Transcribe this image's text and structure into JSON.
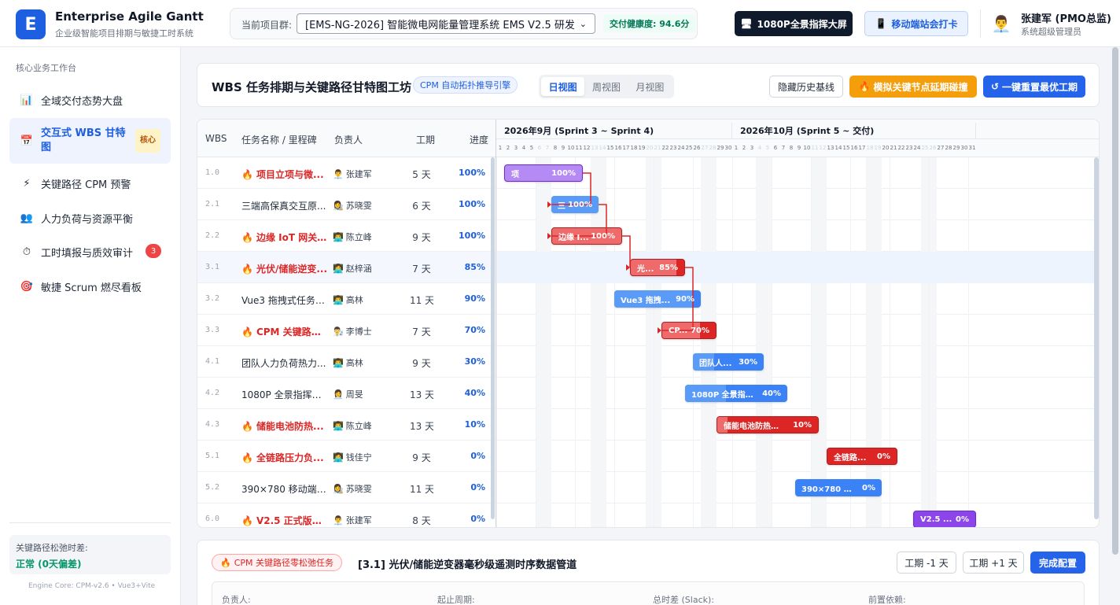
{
  "header": {
    "logo_letter": "E",
    "brand_title": "Enterprise Agile Gantt",
    "brand_sub": "企业级智能项目排期与敏捷工时系统",
    "project_label": "当前项目群:",
    "project_value": "[EMS-NG-2026] 智能微电网能量管理系统 EMS V2.5 研发",
    "health": "交付健康度: 94.6分",
    "screen_btn": "1080P全景指挥大屏",
    "mobile_btn": "移动端站会打卡",
    "user_name": "张建军 (PMO总监)",
    "user_role": "系统超级管理员"
  },
  "sidebar": {
    "title": "核心业务工作台",
    "items": [
      {
        "label": "全域交付态势大盘",
        "icon": "📊"
      },
      {
        "label": "交互式 WBS 甘特图",
        "icon": "📅",
        "badge": "核心"
      },
      {
        "label": "关键路径 CPM 预警",
        "icon": "⚡"
      },
      {
        "label": "人力负荷与资源平衡",
        "icon": "👥"
      },
      {
        "label": "工时填报与质效审计",
        "icon": "⏱",
        "count": "3"
      },
      {
        "label": "敏捷 Scrum 燃尽看板",
        "icon": "🎯"
      }
    ],
    "slack_label": "关键路径松弛时差:",
    "slack_value": "正常 (0天偏差)",
    "engine": "Engine Core: CPM-v2.6 • Vue3+Vite"
  },
  "toolbar": {
    "title": "WBS 任务排期与关键路径甘特图工坊",
    "engine_badge": "CPM 自动拓扑推导引擎",
    "views": [
      "日视图",
      "周视图",
      "月视图"
    ],
    "hide_baseline": "隐藏历史基线",
    "simulate": "模拟关键节点延期碰撞",
    "simulate_icon": "🔥",
    "reset": "一键重置最优工期",
    "reset_icon": "↺"
  },
  "gantt": {
    "columns": {
      "wbs": "WBS",
      "name": "任务名称 / 里程碑",
      "owner": "负责人",
      "duration": "工期",
      "progress": "进度"
    },
    "months": [
      "2026年9月 (Sprint 3 ~ Sprint 4)",
      "2026年10月 (Sprint 5 ~ 交付)"
    ],
    "crit_icon": "🔥",
    "colors": {
      "critical": "#dc2626",
      "normal": "#3b82f6",
      "milestone": "#8b45e8"
    },
    "tasks": [
      {
        "wbs": "1.0",
        "name": "项目立项与微...",
        "bar_name": "项",
        "owner": "张建军",
        "avatar": "👨‍💼",
        "duration": "5 天",
        "progress": "100%",
        "pct": 1.0,
        "critical": true,
        "color": "purple",
        "start": 1,
        "days": 5
      },
      {
        "wbs": "2.1",
        "name": "三端高保真交互原...",
        "bar_name": "三",
        "owner": "苏晓雯",
        "avatar": "👩‍🎨",
        "duration": "6 天",
        "progress": "100%",
        "pct": 1.0,
        "critical": false,
        "color": "blue",
        "start": 4,
        "days": 3
      },
      {
        "wbs": "2.2",
        "name": "边缘 IoT 网关 ...",
        "bar_name": "边缘 I...",
        "owner": "陈立峰",
        "avatar": "👨‍💻",
        "duration": "9 天",
        "progress": "100%",
        "pct": 1.0,
        "critical": true,
        "color": "red",
        "start": 4,
        "days": 4.5
      },
      {
        "wbs": "3.1",
        "name": "光伏/储能逆变...",
        "bar_name": "光...",
        "owner": "赵梓涵",
        "avatar": "👩‍💻",
        "duration": "7 天",
        "progress": "85%",
        "pct": 0.85,
        "critical": true,
        "color": "red",
        "start": 9,
        "days": 3.5
      },
      {
        "wbs": "3.2",
        "name": "Vue3 拖拽式任务排...",
        "bar_name": "Vue3 拖拽...",
        "owner": "高林",
        "avatar": "👨‍💻",
        "duration": "11 天",
        "progress": "90%",
        "pct": 0.9,
        "critical": false,
        "color": "blue",
        "start": 8,
        "days": 5.5
      },
      {
        "wbs": "3.3",
        "name": "CPM 关键路径...",
        "bar_name": "CP...",
        "owner": "李博士",
        "avatar": "👨‍🔬",
        "duration": "7 天",
        "progress": "70%",
        "pct": 0.7,
        "critical": true,
        "color": "red",
        "start": 11,
        "days": 3.5
      },
      {
        "wbs": "4.1",
        "name": "团队人力负荷热力...",
        "bar_name": "团队人...",
        "owner": "高林",
        "avatar": "👨‍💻",
        "duration": "9 天",
        "progress": "30%",
        "pct": 0.3,
        "critical": false,
        "color": "blue",
        "start": 13,
        "days": 4.5
      },
      {
        "wbs": "4.2",
        "name": "1080P 全景指挥数...",
        "bar_name": "1080P 全景指挥...",
        "owner": "周旻",
        "avatar": "👩‍💼",
        "duration": "13 天",
        "progress": "40%",
        "pct": 0.4,
        "critical": false,
        "color": "blue",
        "start": 12.5,
        "days": 6.5
      },
      {
        "wbs": "4.3",
        "name": "储能电池防热...",
        "bar_name": "储能电池防热失...",
        "owner": "陈立峰",
        "avatar": "👨‍💻",
        "duration": "13 天",
        "progress": "10%",
        "pct": 0.1,
        "critical": true,
        "color": "red",
        "start": 14.5,
        "days": 6.5
      },
      {
        "wbs": "5.1",
        "name": "全链路压力负...",
        "bar_name": "全链路...",
        "owner": "钱佳宁",
        "avatar": "👩‍💻",
        "duration": "9 天",
        "progress": "0%",
        "pct": 0.0,
        "critical": true,
        "color": "red",
        "start": 21.5,
        "days": 4.5
      },
      {
        "wbs": "5.2",
        "name": "390×780 移动端敏...",
        "bar_name": "390×780 移...",
        "owner": "苏晓雯",
        "avatar": "👩‍🎨",
        "duration": "11 天",
        "progress": "0%",
        "pct": 0.0,
        "critical": false,
        "color": "blue",
        "start": 19.5,
        "days": 5.5
      },
      {
        "wbs": "6.0",
        "name": "V2.5 正式版本...",
        "bar_name": "V2.5 ...",
        "owner": "张建军",
        "avatar": "👨‍💼",
        "duration": "8 天",
        "progress": "0%",
        "pct": 0.0,
        "critical": true,
        "color": "purple",
        "start": 27,
        "days": 4
      }
    ],
    "selected_row": 3,
    "links": [
      [
        0,
        1
      ],
      [
        1,
        2
      ],
      [
        2,
        3
      ],
      [
        3,
        5
      ]
    ]
  },
  "detail": {
    "badge": "CPM 关键路径零松弛任务",
    "title": "[3.1] 光伏/储能逆变器毫秒级遥测时序数据管道",
    "minus_btn": "工期 -1 天",
    "plus_btn": "工期 +1 天",
    "done_btn": "完成配置",
    "fields": [
      "负责人:",
      "起止周期:",
      "总时差 (Slack):",
      "前置依赖:"
    ]
  }
}
